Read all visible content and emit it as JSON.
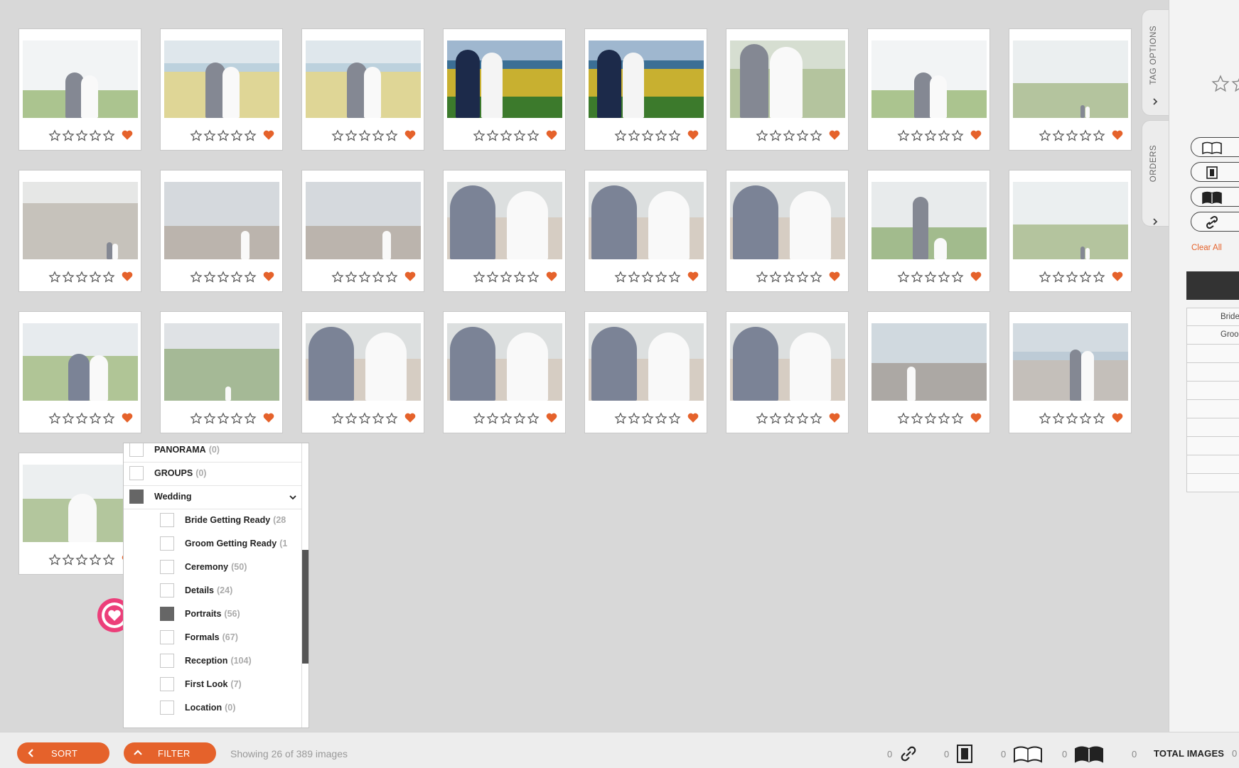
{
  "colors": {
    "accent": "#e5622b",
    "heart": "#e5622b",
    "bubble": "#ec3f7a"
  },
  "gallery": {
    "rows": [
      [
        {
          "scene": "sky-field",
          "vivid": false
        },
        {
          "scene": "marsh",
          "vivid": false
        },
        {
          "scene": "marsh",
          "vivid": false
        },
        {
          "scene": "marsh-vivid",
          "vivid": true
        },
        {
          "scene": "marsh-vivid",
          "vivid": true
        },
        {
          "scene": "bride-closeup",
          "vivid": false
        },
        {
          "scene": "sky-field",
          "vivid": false
        },
        {
          "scene": "field-far",
          "vivid": false
        }
      ],
      [
        {
          "scene": "stairs",
          "vivid": false
        },
        {
          "scene": "rock-beach",
          "vivid": false
        },
        {
          "scene": "rock-beach",
          "vivid": false
        },
        {
          "scene": "beach-couple",
          "vivid": false
        },
        {
          "scene": "beach-couple",
          "vivid": false
        },
        {
          "scene": "beach-couple",
          "vivid": false
        },
        {
          "scene": "marina",
          "vivid": false
        },
        {
          "scene": "field-far",
          "vivid": false
        }
      ],
      [
        {
          "scene": "field-couple",
          "vivid": false
        },
        {
          "scene": "bush-hill",
          "vivid": false
        },
        {
          "scene": "beach-couple",
          "vivid": false
        },
        {
          "scene": "beach-couple",
          "vivid": false
        },
        {
          "scene": "beach-couple",
          "vivid": false
        },
        {
          "scene": "beach-couple",
          "vivid": false
        },
        {
          "scene": "rocks-bride",
          "vivid": false
        },
        {
          "scene": "shore-walk",
          "vivid": false
        }
      ],
      [
        {
          "scene": "bride-field",
          "vivid": false
        }
      ]
    ]
  },
  "filter_menu": {
    "items": [
      {
        "label": "PANORAMA",
        "count": "(0)",
        "level": 0,
        "checked": false
      },
      {
        "label": "GROUPS",
        "count": "(0)",
        "level": 0,
        "checked": false
      },
      {
        "label": "Wedding",
        "count": "",
        "level": 0,
        "checked": true,
        "expandable": true
      },
      {
        "label": "Bride Getting Ready",
        "count": "(28",
        "level": 1,
        "checked": false
      },
      {
        "label": "Groom Getting Ready",
        "count": "(1",
        "level": 1,
        "checked": false
      },
      {
        "label": "Ceremony",
        "count": "(50)",
        "level": 1,
        "checked": false
      },
      {
        "label": "Details",
        "count": "(24)",
        "level": 1,
        "checked": false
      },
      {
        "label": "Portraits",
        "count": "(56)",
        "level": 1,
        "checked": true
      },
      {
        "label": "Formals",
        "count": "(67)",
        "level": 1,
        "checked": false
      },
      {
        "label": "Reception",
        "count": "(104)",
        "level": 1,
        "checked": false
      },
      {
        "label": "First Look",
        "count": "(7)",
        "level": 1,
        "checked": false
      },
      {
        "label": "Location",
        "count": "(0)",
        "level": 1,
        "checked": false
      }
    ]
  },
  "bottom_bar": {
    "sort_label": "SORT",
    "filter_label": "FILTER",
    "showing": "Showing 26 of 389 images",
    "link_count": "0",
    "page_count": "0",
    "open_book_count": "0",
    "closed_book_count": "0",
    "total_label": "TOTAL IMAGES",
    "total_count": "0",
    "extra_count": "0"
  },
  "side_tabs": {
    "tag_options": "TAG OPTIONS",
    "orders": "ORDERS"
  },
  "panel": {
    "clear_all": "Clear All",
    "rows": [
      "Bride",
      "Groon",
      "",
      "",
      "",
      "",
      "",
      "",
      "",
      ""
    ]
  }
}
